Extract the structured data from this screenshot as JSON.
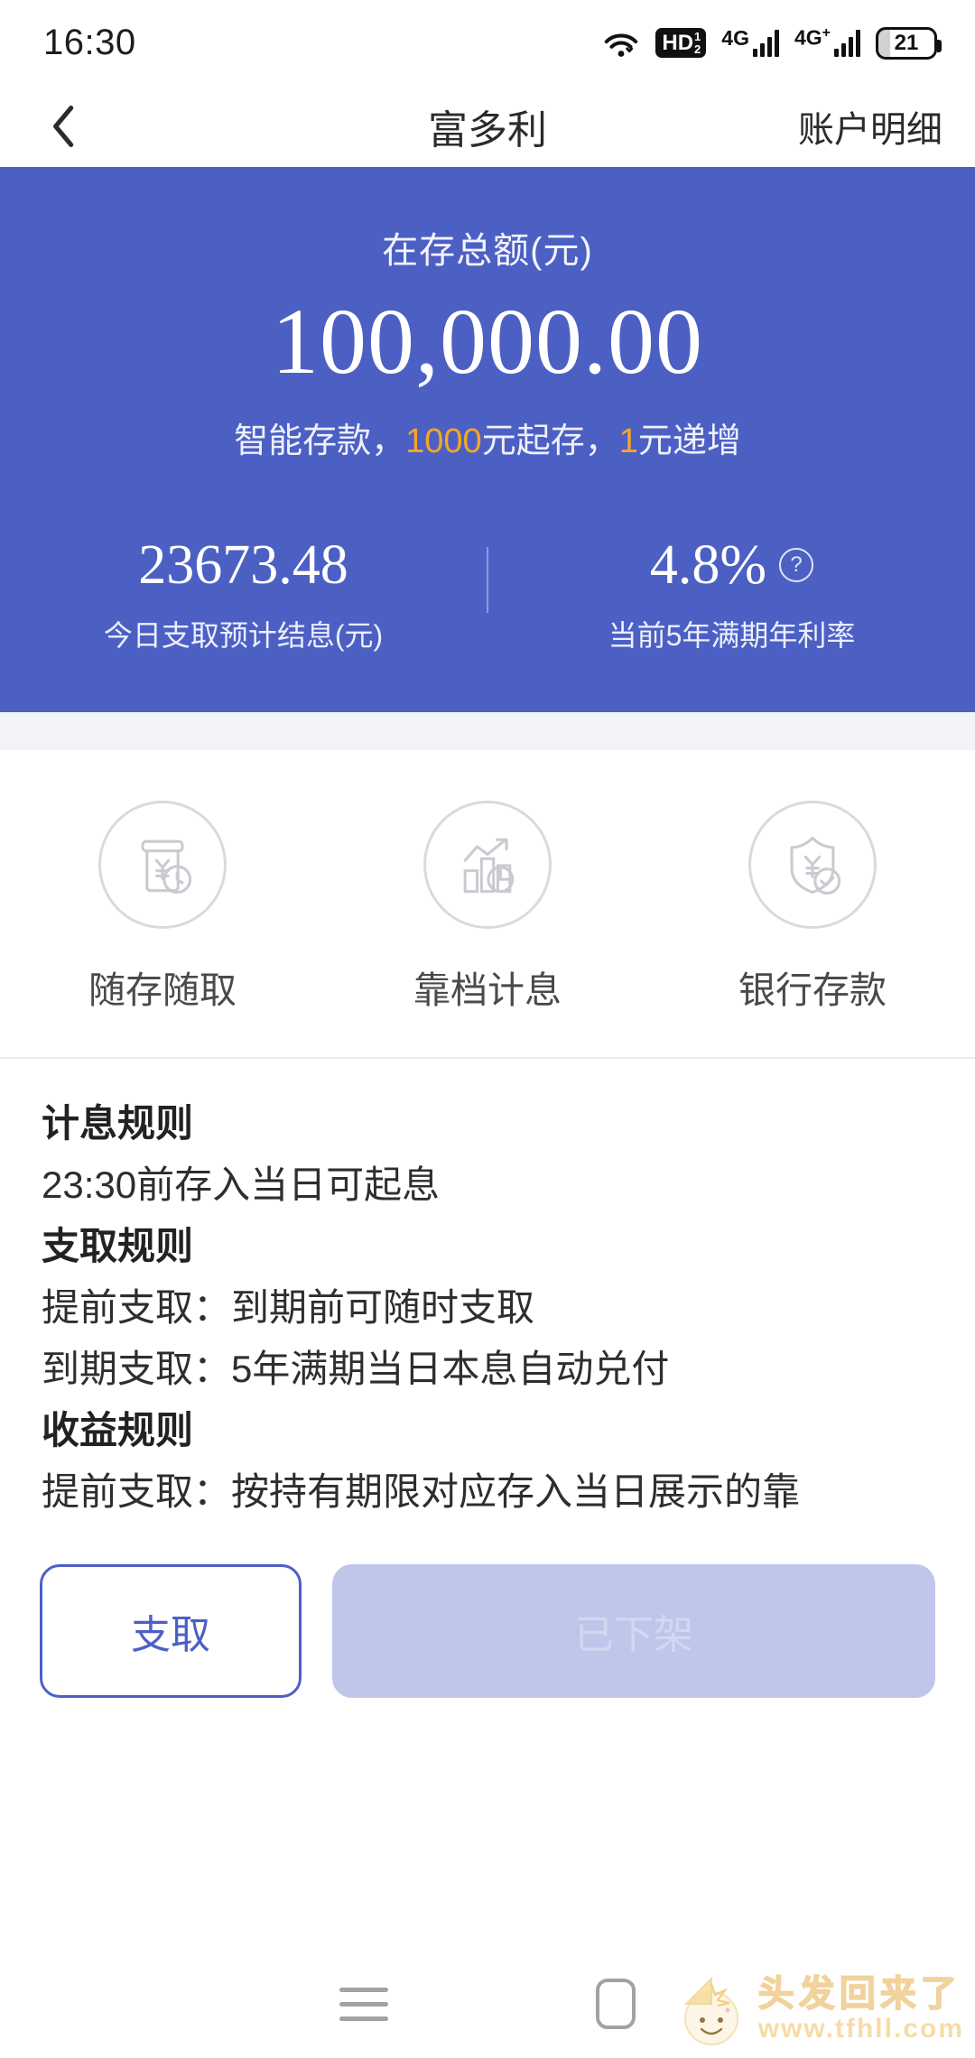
{
  "status_bar": {
    "time": "16:30",
    "icons": [
      "wifi-icon",
      "hd-volte-icon",
      "signal-4g-icon",
      "signal-4g-plus-icon",
      "battery-icon"
    ],
    "volte_label": "HD",
    "volte_sim_top": "1",
    "volte_sim_bottom": "2",
    "network_1": "4G",
    "network_2": "4G",
    "network_2_plus": "+",
    "battery_level": "21"
  },
  "header": {
    "back_icon": "chevron-left-icon",
    "title": "富多利",
    "action_label": "账户明细"
  },
  "hero": {
    "balance_label": "在存总额(元)",
    "balance_value": "100,000.00",
    "subtitle_part1": "智能存款，",
    "subtitle_highlight1": "1000",
    "subtitle_part2": "元起存，",
    "subtitle_highlight2": "1",
    "subtitle_part3": "元递增",
    "background_color": "#4c60c4",
    "highlight_color": "#f5a623",
    "stats": [
      {
        "value": "23673.48",
        "caption": "今日支取预计结息(元)",
        "has_help": false
      },
      {
        "value": "4.8%",
        "caption": "当前5年满期年利率",
        "has_help": true,
        "help_icon": "question-mark-icon"
      }
    ]
  },
  "features": [
    {
      "icon": "deposit-jar-clock-icon",
      "label": "随存随取"
    },
    {
      "icon": "bar-chart-trend-icon",
      "label": "靠档计息"
    },
    {
      "icon": "shield-yuan-check-icon",
      "label": "银行存款"
    }
  ],
  "rules": [
    {
      "type": "heading",
      "text": "计息规则"
    },
    {
      "type": "body",
      "text": "23:30前存入当日可起息"
    },
    {
      "type": "heading",
      "text": "支取规则"
    },
    {
      "type": "body",
      "text": "提前支取：到期前可随时支取"
    },
    {
      "type": "body",
      "text": "到期支取：5年满期当日本息自动兑付"
    },
    {
      "type": "heading",
      "text": "收益规则"
    },
    {
      "type": "body",
      "text": "提前支取：按持有期限对应存入当日展示的靠"
    }
  ],
  "actions": {
    "primary_label": "支取",
    "disabled_label": "已下架",
    "accent_color": "#4c60c4",
    "disabled_color": "#bfc6ea"
  },
  "navbar": {
    "recents_icon": "recents-menu-icon",
    "home_icon": "home-square-icon"
  },
  "watermark": {
    "logo_icon": "cartoon-face-logo",
    "title": "头发回来了",
    "url": "www.tfhll.com"
  }
}
